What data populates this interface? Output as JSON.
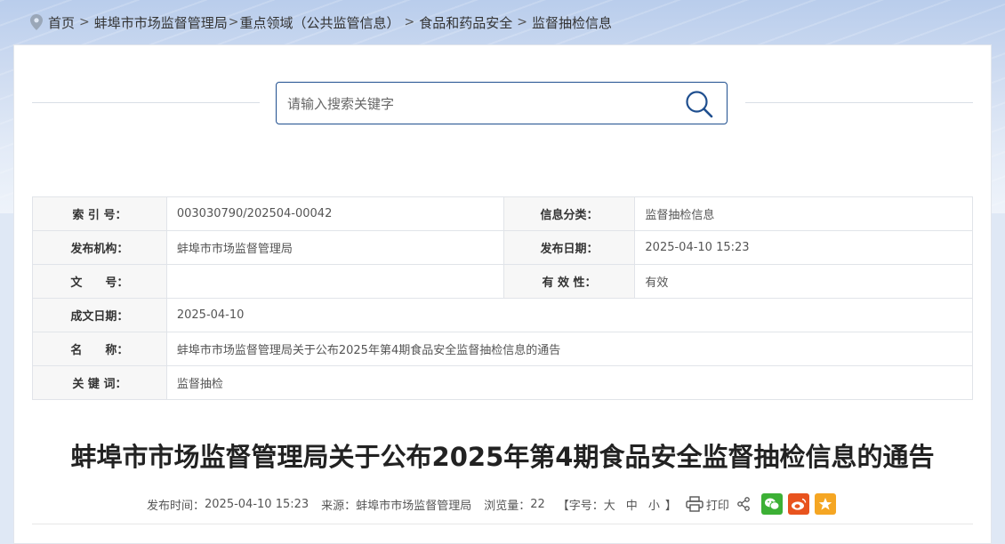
{
  "breadcrumb": [
    {
      "label": "首页"
    },
    {
      "label": "蚌埠市市场监督管理局"
    },
    {
      "label": "重点领域（公共监管信息）"
    },
    {
      "label": "食品和药品安全"
    },
    {
      "label": "监督抽检信息"
    }
  ],
  "breadcrumb_separators": [
    ">",
    ">",
    ">",
    ">"
  ],
  "search": {
    "placeholder": "请输入搜索关键字",
    "value": ""
  },
  "info": {
    "index_label": "索 引 号：",
    "index_value": "003030790/202504-00042",
    "category_label": "信息分类：",
    "category_value": "监督抽检信息",
    "publisher_label": "发布机构：",
    "publisher_value": "蚌埠市市场监督管理局",
    "pubdate_label": "发布日期：",
    "pubdate_value": "2025-04-10 15:23",
    "docno_label": "文　　号：",
    "docno_value": "",
    "validity_label": "有 效 性：",
    "validity_value": "有效",
    "created_label": "成文日期：",
    "created_value": "2025-04-10",
    "name_label": "名　　称：",
    "name_value": "蚌埠市市场监督管理局关于公布2025年第4期食品安全监督抽检信息的通告",
    "keywords_label": "关 键 词：",
    "keywords_value": "监督抽检"
  },
  "article": {
    "title": "蚌埠市市场监督管理局关于公布2025年第4期食品安全监督抽检信息的通告",
    "meta": {
      "time_label": "发布时间：",
      "time_value": "2025-04-10 15:23",
      "source_label": "来源：",
      "source_value": "蚌埠市市场监督管理局",
      "views_label": "浏览量：",
      "views_value": "22",
      "fontsize_open": "【字号：",
      "fontsize_large": "大",
      "fontsize_medium": "中",
      "fontsize_small": "小",
      "fontsize_close": "】",
      "print_label": "打印"
    }
  },
  "colors": {
    "accent": "#1f4f8f",
    "wechat": "#3cb035",
    "weibo": "#e8531e",
    "favorite": "#f5a623"
  },
  "icons": [
    "location-pin-icon",
    "search-icon",
    "printer-icon",
    "share-icon",
    "wechat-icon",
    "weibo-icon",
    "star-icon"
  ]
}
